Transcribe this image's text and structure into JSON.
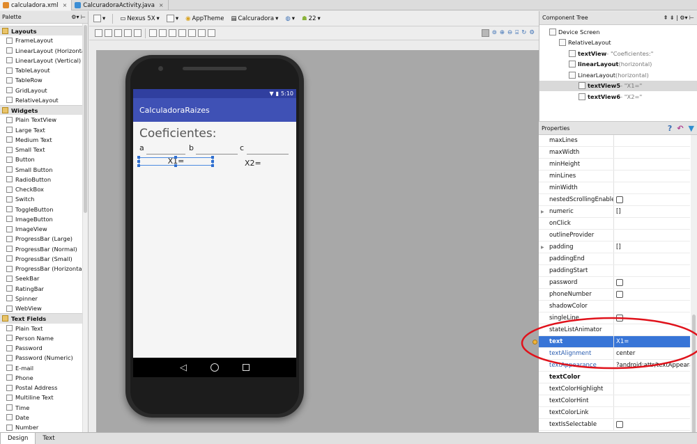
{
  "tabs": [
    {
      "label": "calculadora.xml",
      "icon": "xml-file-icon",
      "color": "#e08a2c"
    },
    {
      "label": "CalcuradoraActivity.java",
      "icon": "class-icon",
      "color": "#3b8dd4"
    }
  ],
  "palette": {
    "title": "Palette",
    "items": [
      {
        "label": "Layouts",
        "cat": true
      },
      {
        "label": "FrameLayout"
      },
      {
        "label": "LinearLayout (Horizontal)"
      },
      {
        "label": "LinearLayout (Vertical)"
      },
      {
        "label": "TableLayout"
      },
      {
        "label": "TableRow"
      },
      {
        "label": "GridLayout"
      },
      {
        "label": "RelativeLayout"
      },
      {
        "label": "Widgets",
        "cat": true
      },
      {
        "label": "Plain TextView"
      },
      {
        "label": "Large Text"
      },
      {
        "label": "Medium Text"
      },
      {
        "label": "Small Text"
      },
      {
        "label": "Button"
      },
      {
        "label": "Small Button"
      },
      {
        "label": "RadioButton"
      },
      {
        "label": "CheckBox"
      },
      {
        "label": "Switch"
      },
      {
        "label": "ToggleButton"
      },
      {
        "label": "ImageButton"
      },
      {
        "label": "ImageView"
      },
      {
        "label": "ProgressBar (Large)"
      },
      {
        "label": "ProgressBar (Normal)"
      },
      {
        "label": "ProgressBar (Small)"
      },
      {
        "label": "ProgressBar (Horizontal)"
      },
      {
        "label": "SeekBar"
      },
      {
        "label": "RatingBar"
      },
      {
        "label": "Spinner"
      },
      {
        "label": "WebView"
      },
      {
        "label": "Text Fields",
        "cat": true
      },
      {
        "label": "Plain Text"
      },
      {
        "label": "Person Name"
      },
      {
        "label": "Password"
      },
      {
        "label": "Password (Numeric)"
      },
      {
        "label": "E-mail"
      },
      {
        "label": "Phone"
      },
      {
        "label": "Postal Address"
      },
      {
        "label": "Multiline Text"
      },
      {
        "label": "Time"
      },
      {
        "label": "Date"
      },
      {
        "label": "Number"
      }
    ]
  },
  "toolbar": {
    "device": "Nexus 5X",
    "theme": "AppTheme",
    "activity": "Calcuradora",
    "api": "22"
  },
  "phone": {
    "time": "5:10",
    "app_title": "CalculadoraRaizes",
    "heading": "Coeficientes:",
    "label_a": "a",
    "label_b": "b",
    "label_c": "c",
    "x1": "X1=",
    "x2": "X2="
  },
  "component_tree": {
    "title": "Component Tree",
    "nodes": [
      {
        "name": "Device Screen",
        "extra": "",
        "bold": false,
        "depth": 0
      },
      {
        "name": "RelativeLayout",
        "extra": "",
        "bold": false,
        "depth": 1
      },
      {
        "name": "textView",
        "extra": " - \"Coeficientes:\"",
        "bold": true,
        "depth": 2
      },
      {
        "name": "linearLayout",
        "extra": " (horizontal)",
        "bold": true,
        "depth": 2
      },
      {
        "name": "LinearLayout",
        "extra": " (horizontal)",
        "bold": false,
        "depth": 2
      },
      {
        "name": "textView5",
        "extra": " - \"X1=\"",
        "bold": true,
        "depth": 3,
        "selected": true
      },
      {
        "name": "textView6",
        "extra": " - \"X2=\"",
        "bold": true,
        "depth": 3
      }
    ]
  },
  "properties": {
    "title": "Properties",
    "rows": [
      {
        "name": "maxLines",
        "value": ""
      },
      {
        "name": "maxWidth",
        "value": ""
      },
      {
        "name": "minHeight",
        "value": ""
      },
      {
        "name": "minLines",
        "value": ""
      },
      {
        "name": "minWidth",
        "value": ""
      },
      {
        "name": "nestedScrollingEnabled",
        "value": "",
        "checkbox": true
      },
      {
        "name": "numeric",
        "value": "[]",
        "expand": true
      },
      {
        "name": "onClick",
        "value": ""
      },
      {
        "name": "outlineProvider",
        "value": ""
      },
      {
        "name": "padding",
        "value": "[]",
        "expand": true
      },
      {
        "name": "paddingEnd",
        "value": ""
      },
      {
        "name": "paddingStart",
        "value": ""
      },
      {
        "name": "password",
        "value": "",
        "checkbox": true
      },
      {
        "name": "phoneNumber",
        "value": "",
        "checkbox": true
      },
      {
        "name": "shadowColor",
        "value": ""
      },
      {
        "name": "singleLine",
        "value": "",
        "checkbox": true
      },
      {
        "name": "stateListAnimator",
        "value": ""
      },
      {
        "name": "text",
        "value": "X1=",
        "selected": true,
        "bold": true
      },
      {
        "name": "textAlignment",
        "value": "center",
        "blue": true
      },
      {
        "name": "textAppearance",
        "value": "?android:attr/textAppearanc",
        "blue": true
      },
      {
        "name": "textColor",
        "value": "",
        "bold": true
      },
      {
        "name": "textColorHighlight",
        "value": ""
      },
      {
        "name": "textColorHint",
        "value": ""
      },
      {
        "name": "textColorLink",
        "value": ""
      },
      {
        "name": "textIsSelectable",
        "value": "",
        "checkbox": true
      }
    ]
  },
  "bottom_tabs": [
    "Design",
    "Text"
  ],
  "colors": {
    "primary": "#3f51b5",
    "primary_dark": "#303f9f",
    "selection": "#3875d7",
    "annotation": "#e0121b"
  }
}
